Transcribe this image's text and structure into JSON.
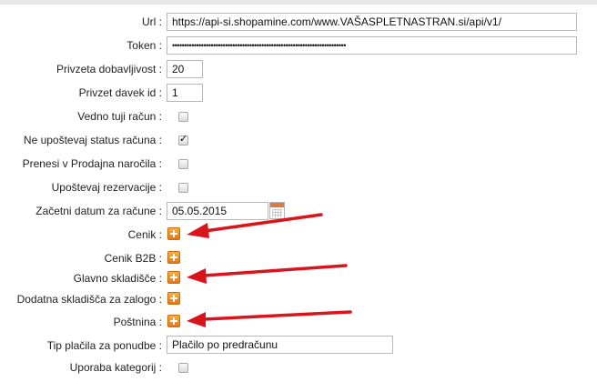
{
  "form": {
    "url": {
      "label": "Url :",
      "value": "https://api-si.shopamine.com/www.VAŠASPLETNASTRAN.si/api/v1/"
    },
    "token": {
      "label": "Token :",
      "value": "••••••••••••••••••••••••••••••••••••••••••••••••••••••••••••••••••••••••"
    },
    "privzeta_dobavljivost": {
      "label": "Privzeta dobavljivost :",
      "value": "20"
    },
    "privzet_davek_id": {
      "label": "Privzet davek id :",
      "value": "1"
    },
    "vedno_tuji_racun": {
      "label": "Vedno tuji račun :",
      "checked": false
    },
    "ne_upostevaj_status": {
      "label": "Ne upoštevaj status računa :",
      "checked": true
    },
    "prenesi_v_prodajna": {
      "label": "Prenesi v Prodajna naročila :",
      "checked": false
    },
    "upostevaj_rezervacije": {
      "label": "Upoštevaj rezervacije :",
      "checked": false
    },
    "zacetni_datum": {
      "label": "Začetni datum za račune :",
      "value": "05.05.2015"
    },
    "cenik": {
      "label": "Cenik :"
    },
    "cenik_b2b": {
      "label": "Cenik B2B :"
    },
    "glavno_skladisce": {
      "label": "Glavno skladišče :"
    },
    "dodatna_skladisca": {
      "label": "Dodatna skladišča za zalogo :"
    },
    "postnina": {
      "label": "Poštnina :"
    },
    "tip_placila": {
      "label": "Tip plačila za ponudbe :",
      "value": "Plačilo po predračunu"
    },
    "uporaba_kategorij": {
      "label": "Uporaba kategorij :",
      "checked": false
    }
  },
  "icons": {
    "add": "plus-square-icon",
    "calendar": "calendar-icon",
    "annotation": "red-arrow"
  },
  "colors": {
    "add_icon": "#f09a2e",
    "arrow": "#d9141b",
    "checkbox_border": "#a8a8a8"
  }
}
